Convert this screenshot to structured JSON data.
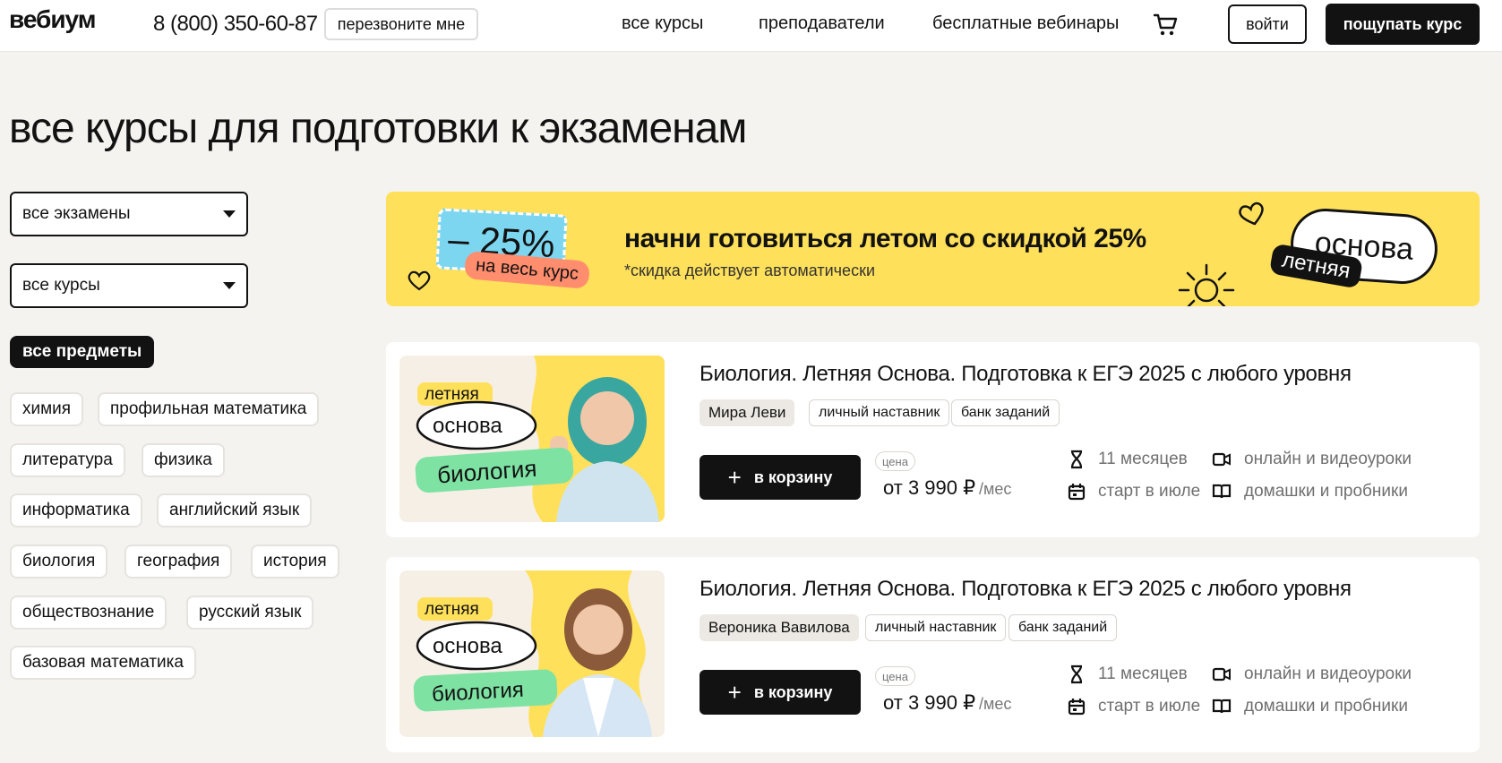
{
  "header": {
    "logo": "вебиум",
    "phone": "8 (800) 350-60-87",
    "callback": "перезвоните мне",
    "nav": [
      "все курсы",
      "преподаватели",
      "бесплатные вебинары"
    ],
    "login": "войти",
    "buy": "пощупать курс"
  },
  "page_title": "все курсы для подготовки к экзаменам",
  "filters": {
    "exam_select": "все экзамены",
    "course_select": "все курсы",
    "subjects": [
      "все предметы",
      "химия",
      "профильная математика",
      "литература",
      "физика",
      "информатика",
      "английский язык",
      "биология",
      "география",
      "история",
      "обществознание",
      "русский язык",
      "базовая математика"
    ]
  },
  "promo": {
    "discount": "– 25%",
    "discount_tag": "на весь курс",
    "title": "начни готовиться летом со скидкой 25%",
    "subtitle": "*скидка действует автоматически",
    "badge_main": "основа",
    "badge_tag": "летняя"
  },
  "course_image_text": {
    "line1": "летняя",
    "line2": "основа",
    "line3": "биология"
  },
  "courses": [
    {
      "title": "Биология. Летняя Основа. Подготовка к ЕГЭ 2025 с любого уровня",
      "teacher": "Мира Леви",
      "tags": [
        "личный наставник",
        "банк заданий"
      ],
      "cart_label": "в корзину",
      "price_label": "цена",
      "price": "от 3 990 ₽",
      "price_unit": "/мес",
      "features": [
        "11 месяцев",
        "старт в июле",
        "онлайн и видеоуроки",
        "домашки и пробники"
      ]
    },
    {
      "title": "Биология. Летняя Основа. Подготовка к ЕГЭ 2025 с любого уровня",
      "teacher": "Вероника Вавилова",
      "tags": [
        "личный наставник",
        "банк заданий"
      ],
      "cart_label": "в корзину",
      "price_label": "цена",
      "price": "от 3 990 ₽",
      "price_unit": "/мес",
      "features": [
        "11 месяцев",
        "старт в июле",
        "онлайн и видеоуроки",
        "домашки и пробники"
      ]
    }
  ],
  "colors": {
    "accent_yellow": "#ffe05a",
    "dark": "#121212",
    "background": "#f5f3f0",
    "image_green": "#7ee2a3"
  }
}
